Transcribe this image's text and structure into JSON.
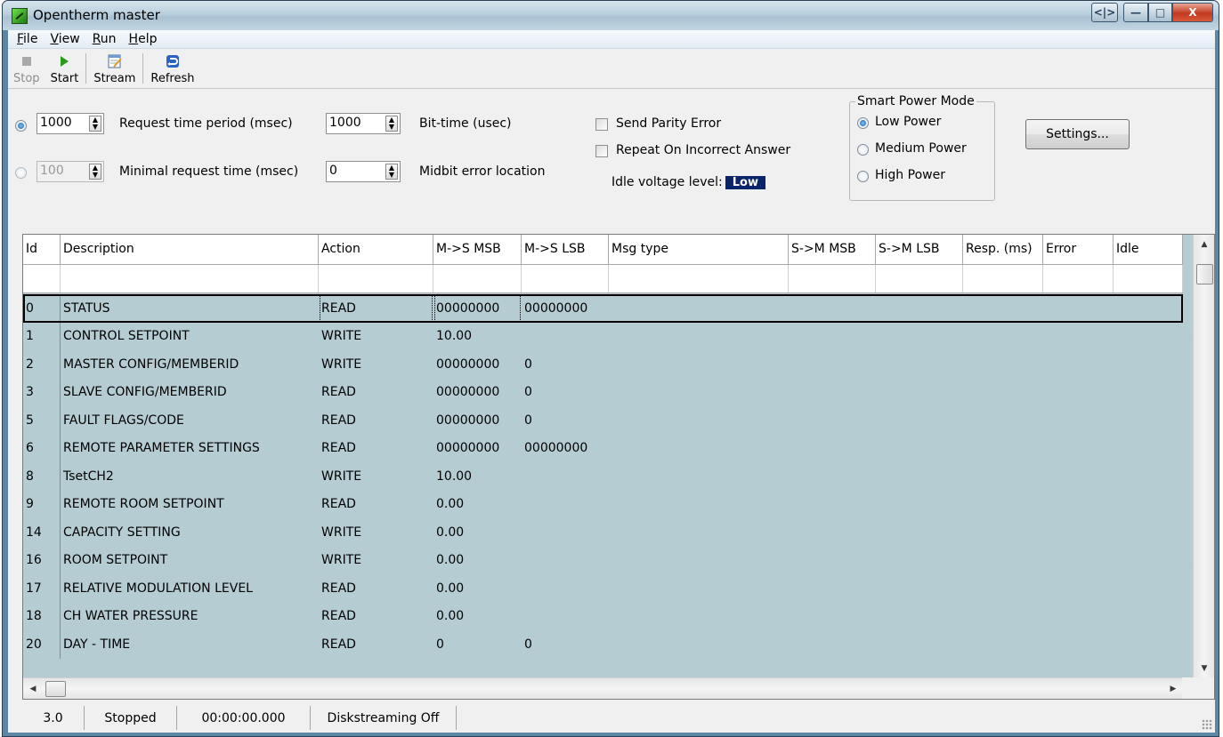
{
  "window": {
    "title": "Opentherm master",
    "controls": {
      "extra": "<|>",
      "minimize": "—",
      "maximize": "□",
      "close": "X"
    }
  },
  "menu": [
    {
      "acc": "F",
      "rest": "ile"
    },
    {
      "acc": "V",
      "rest": "iew"
    },
    {
      "acc": "R",
      "rest": "un"
    },
    {
      "acc": "H",
      "rest": "elp"
    }
  ],
  "toolbar": {
    "stop": "Stop",
    "start": "Start",
    "stream": "Stream",
    "refresh": "Refresh"
  },
  "panel": {
    "request_period_value": "1000",
    "request_period_label": "Request time period (msec)",
    "bit_time_value": "1000",
    "bit_time_label": "Bit-time (usec)",
    "min_request_value": "100",
    "min_request_label": "Minimal request time (msec)",
    "midbit_value": "0",
    "midbit_label": "Midbit error location",
    "send_parity_label": "Send Parity Error",
    "repeat_label": "Repeat On Incorrect Answer",
    "idle_voltage_label": "Idle voltage level:",
    "idle_voltage_value": "Low",
    "smart_power_title": "Smart Power Mode",
    "power_modes": [
      "Low Power",
      "Medium Power",
      "High Power"
    ],
    "settings_button": "Settings..."
  },
  "grid": {
    "columns": [
      "Id",
      "Description",
      "Action",
      "M->S MSB",
      "M->S LSB",
      "Msg type",
      "S->M MSB",
      "S->M LSB",
      "Resp. (ms)",
      "Error",
      "Idle"
    ],
    "rows": [
      {
        "id": "0",
        "desc": "STATUS",
        "action": "READ",
        "mmsb": "00000000",
        "mlsb": "00000000"
      },
      {
        "id": "1",
        "desc": "CONTROL SETPOINT",
        "action": "WRITE",
        "mmsb": "10.00",
        "mlsb": ""
      },
      {
        "id": "2",
        "desc": "MASTER CONFIG/MEMBERID",
        "action": "WRITE",
        "mmsb": "00000000",
        "mlsb": "0"
      },
      {
        "id": "3",
        "desc": "SLAVE CONFIG/MEMBERID",
        "action": "READ",
        "mmsb": "00000000",
        "mlsb": "0"
      },
      {
        "id": "5",
        "desc": "FAULT FLAGS/CODE",
        "action": "READ",
        "mmsb": "00000000",
        "mlsb": "0"
      },
      {
        "id": "6",
        "desc": "REMOTE PARAMETER SETTINGS",
        "action": "READ",
        "mmsb": "00000000",
        "mlsb": "00000000"
      },
      {
        "id": "8",
        "desc": "TsetCH2",
        "action": "WRITE",
        "mmsb": "10.00",
        "mlsb": ""
      },
      {
        "id": "9",
        "desc": "REMOTE ROOM SETPOINT",
        "action": "READ",
        "mmsb": "0.00",
        "mlsb": ""
      },
      {
        "id": "14",
        "desc": "CAPACITY SETTING",
        "action": "WRITE",
        "mmsb": "0.00",
        "mlsb": ""
      },
      {
        "id": "16",
        "desc": "ROOM SETPOINT",
        "action": "WRITE",
        "mmsb": "0.00",
        "mlsb": ""
      },
      {
        "id": "17",
        "desc": "RELATIVE MODULATION LEVEL",
        "action": "READ",
        "mmsb": "0.00",
        "mlsb": ""
      },
      {
        "id": "18",
        "desc": "CH WATER PRESSURE",
        "action": "READ",
        "mmsb": "0.00",
        "mlsb": ""
      },
      {
        "id": "20",
        "desc": "DAY - TIME",
        "action": "READ",
        "mmsb": "0",
        "mlsb": "0"
      }
    ]
  },
  "statusbar": {
    "version": "3.0",
    "state": "Stopped",
    "time": "00:00:00.000",
    "disk": "Diskstreaming Off"
  },
  "colors": {
    "grid_background": "#b6ccd3",
    "idle_badge": "#0a246a"
  }
}
